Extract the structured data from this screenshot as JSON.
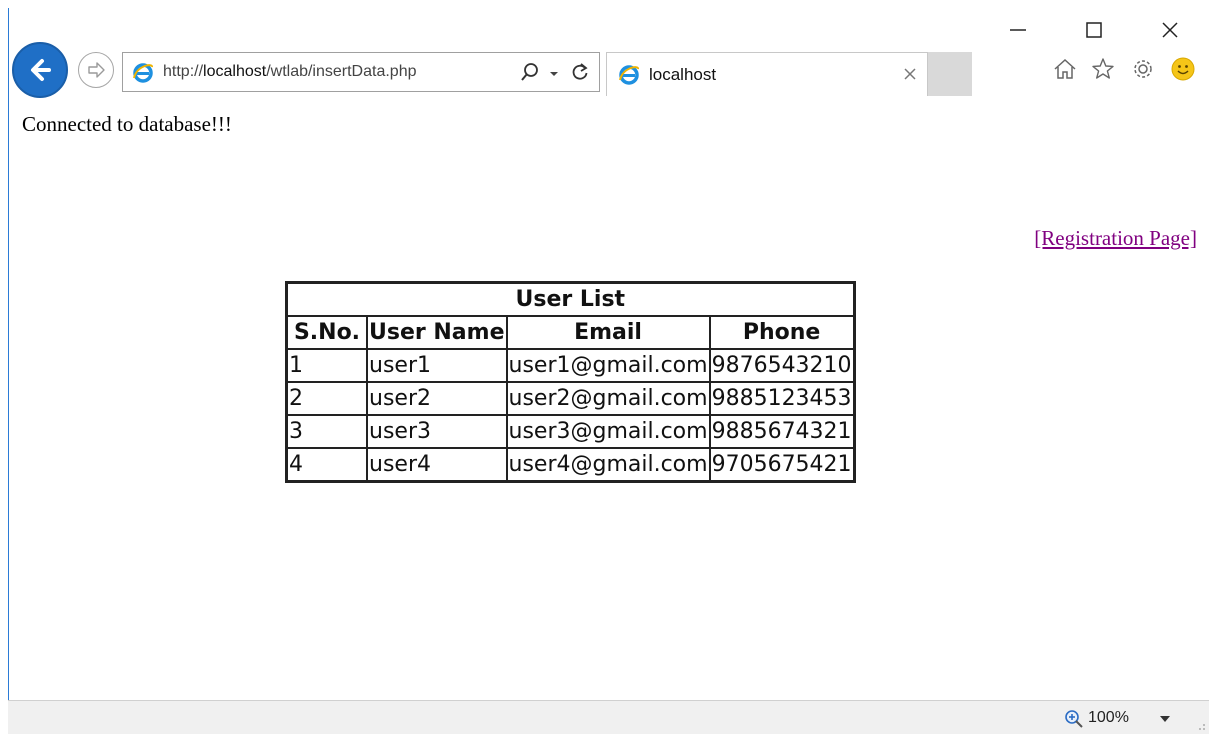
{
  "browser": {
    "address": {
      "scheme": "http://",
      "host": "localhost",
      "path": "/wtlab/insertData.php"
    },
    "tab": {
      "label": "localhost"
    },
    "icons": {
      "back": "back-arrow-icon",
      "forward": "forward-arrow-icon",
      "search": "search-icon",
      "refresh": "refresh-icon",
      "home": "home-icon",
      "favorites": "star-icon",
      "tools": "gear-icon",
      "feedback": "smiley-icon"
    },
    "accent_color": "#1f6fc6"
  },
  "page": {
    "status_message": "Connected to database!!!",
    "registration_link": "[Registration Page]",
    "table": {
      "caption": "User List",
      "headers": [
        "S.No.",
        "User Name",
        "Email",
        "Phone"
      ],
      "rows": [
        [
          "1",
          "user1",
          "user1@gmail.com",
          "9876543210"
        ],
        [
          "2",
          "user2",
          "user2@gmail.com",
          "9885123453"
        ],
        [
          "3",
          "user3",
          "user3@gmail.com",
          "9885674321"
        ],
        [
          "4",
          "user4",
          "user4@gmail.com",
          "9705675421"
        ]
      ]
    },
    "link_color": "#800080"
  },
  "statusbar": {
    "zoom": "100%"
  }
}
